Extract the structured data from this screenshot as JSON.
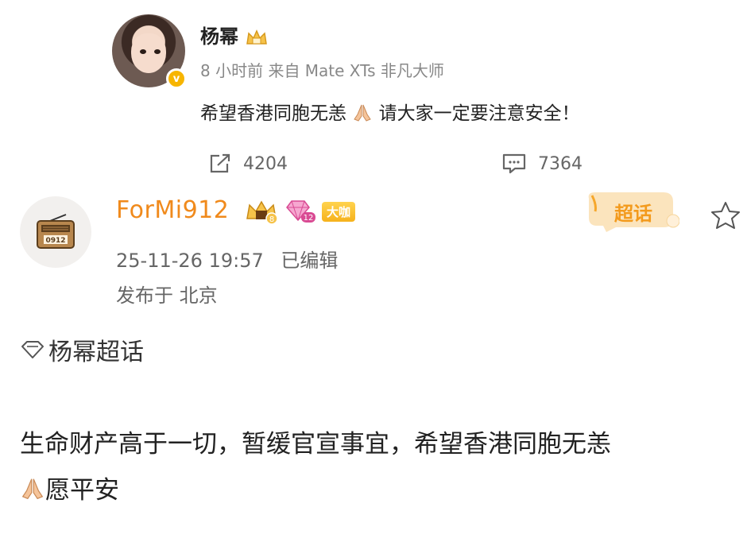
{
  "quoted_post": {
    "author": "杨幂",
    "meta": "8 小时前 来自 Mate XTs 非凡大师",
    "text_before_emoji": "希望香港同胞无恙",
    "text_after_emoji": "请大家一定要注意安全！",
    "repost_count": "4204",
    "comment_count": "7364"
  },
  "post": {
    "author": "ForMi912",
    "fan_level": "8",
    "diamond_level": "12",
    "badge_label": "大咖",
    "supertopic_tag": "超话",
    "timestamp": "25-11-26 19:57",
    "edited": "已编辑",
    "location": "发布于 北京",
    "topic": "杨幂超话",
    "body_line1": "生命财产高于一切，暂缓官宣事宜，希望香港同胞无恙",
    "body_line2": "愿平安"
  },
  "icons": {
    "verified": "verified-badge-icon",
    "crown": "crown-icon",
    "repost": "repost-icon",
    "comment": "comment-icon",
    "radio": "radio-avatar-icon",
    "diamond": "diamond-icon",
    "star": "star-icon",
    "pray": "praying-hands-emoji"
  },
  "colors": {
    "username_orange": "#f08a1c",
    "verified_gold": "#f7b500",
    "meta_gray": "#888888"
  }
}
